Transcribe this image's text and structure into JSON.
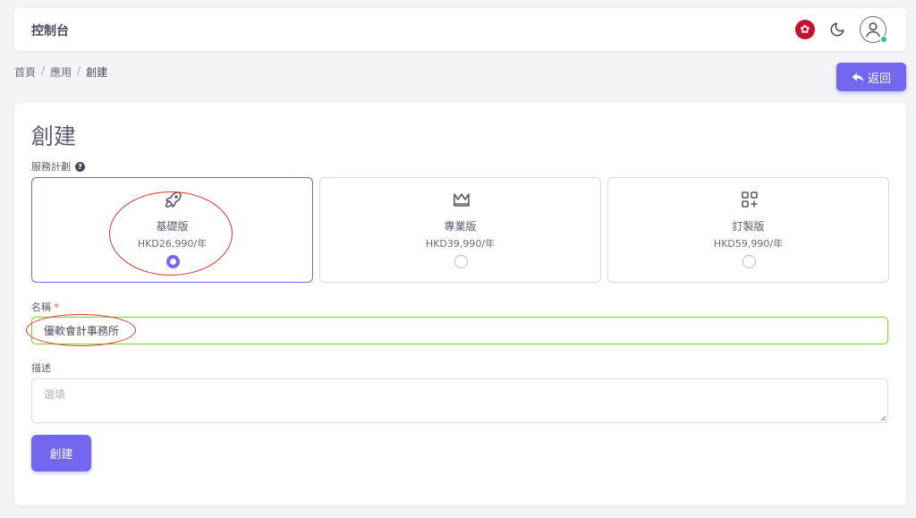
{
  "navbar": {
    "brand": "控制台"
  },
  "breadcrumb": {
    "home": "首頁",
    "apps": "應用",
    "current": "創建",
    "sep": "/"
  },
  "back_button": {
    "label": "返回"
  },
  "page": {
    "title": "創建"
  },
  "plan_section": {
    "label": "服務計劃",
    "help": "?"
  },
  "plans": [
    {
      "name": "基礎版",
      "price": "HKD26,990/年",
      "icon": "rocket-icon",
      "selected": true
    },
    {
      "name": "專業版",
      "price": "HKD39,990/年",
      "icon": "crown-icon",
      "selected": false
    },
    {
      "name": "訂製版",
      "price": "HKD59,990/年",
      "icon": "grid-plus-icon",
      "selected": false
    }
  ],
  "name_field": {
    "label": "名稱",
    "required_mark": "*",
    "value": "優軟會計事務所"
  },
  "description_field": {
    "label": "描述",
    "placeholder": "選填"
  },
  "create_button": {
    "label": "創建"
  },
  "colors": {
    "primary": "#7367f0",
    "success": "#28c76f",
    "valid_border": "#7ed321",
    "annotation": "#e0352b"
  }
}
